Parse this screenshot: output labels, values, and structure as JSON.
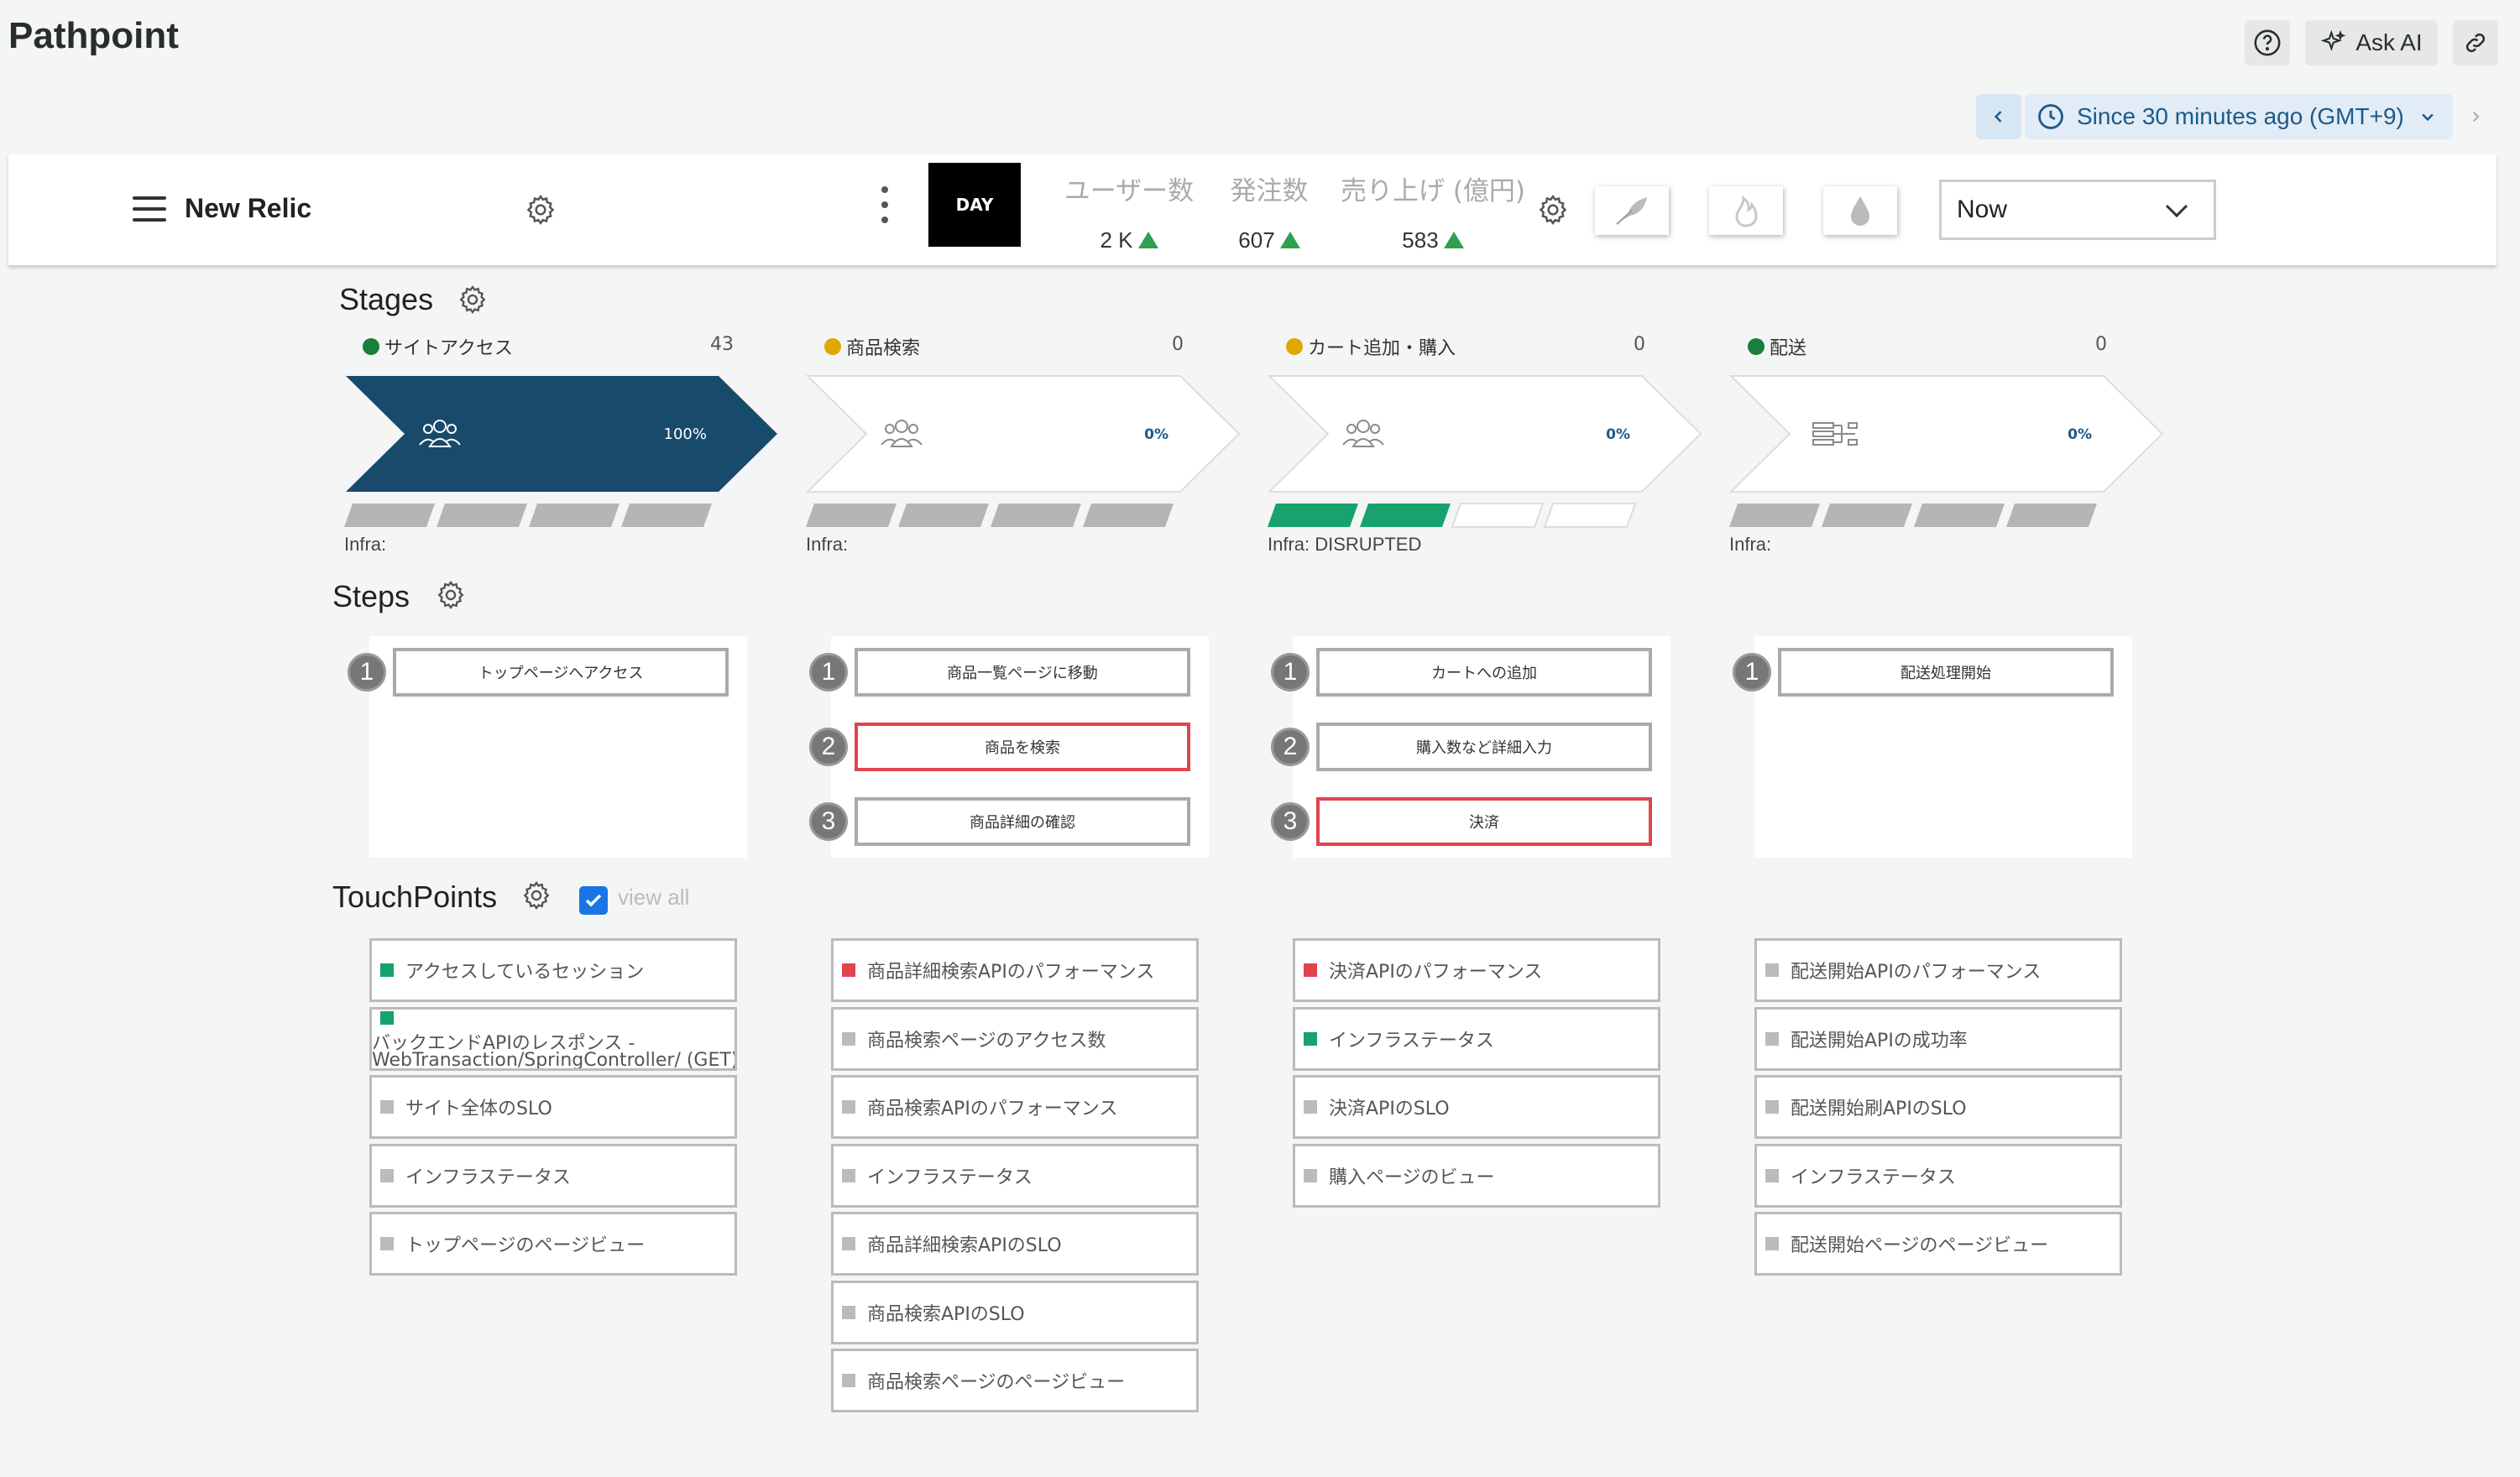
{
  "header": {
    "title": "Pathpoint",
    "help_icon": "question-circle-icon",
    "ask_ai_label": "Ask AI",
    "link_icon": "link-icon"
  },
  "time_picker": {
    "prev_icon": "chevron-left-icon",
    "label": "Since 30 minutes ago (GMT+9)",
    "next_icon": "chevron-right-icon"
  },
  "navbar": {
    "brand": "New Relic",
    "day_label": "DAY",
    "kpis": [
      {
        "label": "ユーザー数",
        "value": "2 K"
      },
      {
        "label": "発注数",
        "value": "607"
      },
      {
        "label": "売り上げ (億円)",
        "value": "583"
      }
    ],
    "modes": [
      "feather-icon",
      "flame-icon",
      "drop-icon"
    ],
    "time_select": "Now"
  },
  "stages": {
    "title": "Stages",
    "items": [
      {
        "name": "サイトアクセス",
        "count": "43",
        "percent": "100%",
        "dot_color": "#1a7f3c",
        "active": true,
        "icon": "users-icon",
        "infra": "Infra:",
        "segments": [
          "gray",
          "gray",
          "gray",
          "gray"
        ]
      },
      {
        "name": "商品検索",
        "count": "0",
        "percent": "0%",
        "dot_color": "#e0a800",
        "active": false,
        "icon": "users-icon",
        "infra": "Infra:",
        "segments": [
          "gray",
          "gray",
          "gray",
          "gray"
        ]
      },
      {
        "name": "カート追加・購入",
        "count": "0",
        "percent": "0%",
        "dot_color": "#e0a800",
        "active": false,
        "icon": "users-icon",
        "infra": "Infra: DISRUPTED",
        "segments": [
          "green",
          "green",
          "white",
          "white"
        ]
      },
      {
        "name": "配送",
        "count": "0",
        "percent": "0%",
        "dot_color": "#1a7f3c",
        "active": false,
        "icon": "network-icon",
        "infra": "Infra:",
        "segments": [
          "gray",
          "gray",
          "gray",
          "gray"
        ]
      }
    ]
  },
  "steps": {
    "title": "Steps",
    "columns": [
      [
        {
          "num": "1",
          "label": "トップページへアクセス",
          "alert": false
        }
      ],
      [
        {
          "num": "1",
          "label": "商品一覧ページに移動",
          "alert": false
        },
        {
          "num": "2",
          "label": "商品を検索",
          "alert": true
        },
        {
          "num": "3",
          "label": "商品詳細の確認",
          "alert": false
        }
      ],
      [
        {
          "num": "1",
          "label": "カートへの追加",
          "alert": false
        },
        {
          "num": "2",
          "label": "購入数など詳細入力",
          "alert": false
        },
        {
          "num": "3",
          "label": "決済",
          "alert": true
        }
      ],
      [
        {
          "num": "1",
          "label": "配送処理開始",
          "alert": false
        }
      ]
    ]
  },
  "touchpoints": {
    "title": "TouchPoints",
    "view_all": "view all",
    "columns": [
      [
        {
          "label": "アクセスしているセッション",
          "status": "green"
        },
        {
          "label": "バックエンドAPIのレスポンス -",
          "label2": "WebTransaction/SpringController/ (GET)",
          "status": "green"
        },
        {
          "label": "サイト全体のSLO",
          "status": "gray"
        },
        {
          "label": "インフラステータス",
          "status": "gray"
        },
        {
          "label": "トップページのページビュー",
          "status": "gray"
        }
      ],
      [
        {
          "label": "商品詳細検索APIのパフォーマンス",
          "status": "red"
        },
        {
          "label": "商品検索ページのアクセス数",
          "status": "gray"
        },
        {
          "label": "商品検索APIのパフォーマンス",
          "status": "gray"
        },
        {
          "label": "インフラステータス",
          "status": "gray"
        },
        {
          "label": "商品詳細検索APIのSLO",
          "status": "gray"
        },
        {
          "label": "商品検索APIのSLO",
          "status": "gray"
        },
        {
          "label": "商品検索ページのページビュー",
          "status": "gray"
        }
      ],
      [
        {
          "label": "決済APIのパフォーマンス",
          "status": "red"
        },
        {
          "label": "インフラステータス",
          "status": "green"
        },
        {
          "label": "決済APIのSLO",
          "status": "gray"
        },
        {
          "label": "購入ページのビュー",
          "status": "gray"
        }
      ],
      [
        {
          "label": "配送開始APIのパフォーマンス",
          "status": "gray"
        },
        {
          "label": "配送開始APIの成功率",
          "status": "gray"
        },
        {
          "label": "配送開始刷APIのSLO",
          "status": "gray"
        },
        {
          "label": "インフラステータス",
          "status": "gray"
        },
        {
          "label": "配送開始ページのページビュー",
          "status": "gray"
        }
      ]
    ]
  },
  "colors": {
    "stage_active": "#184a6b",
    "status_green": "#16a36e",
    "status_red": "#e0444f",
    "status_gray": "#bbbbbb",
    "alert_border": "#e0444f",
    "kpi_up": "#2ea04f"
  }
}
